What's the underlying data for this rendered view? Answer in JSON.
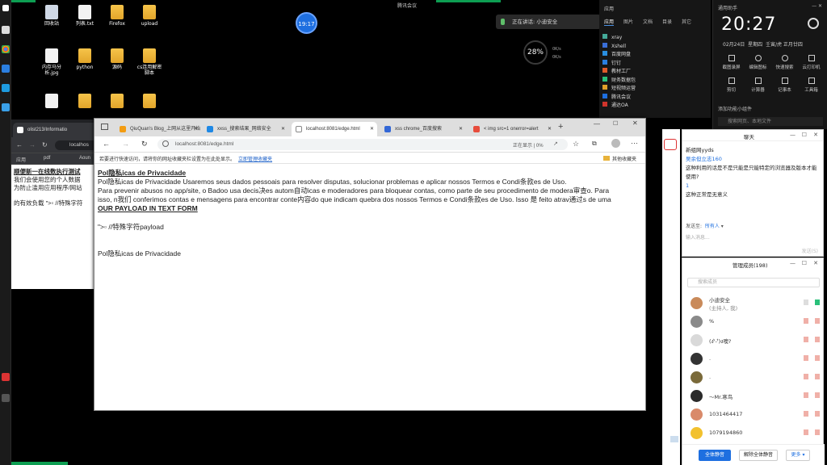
{
  "desktop": {
    "icons": [
      {
        "label": "回收站"
      },
      {
        "label": "列表.txt"
      },
      {
        "label": "Firefox"
      },
      {
        "label": "upload"
      },
      {
        "label": "内存马分析.jpg"
      },
      {
        "label": "python"
      },
      {
        "label": "源码"
      },
      {
        "label": "cs连用解密脚本"
      }
    ],
    "meeting_timer": "19:17",
    "top_meeting_text": "腾讯会议",
    "speaking_text": "正在讲话: 小迪安全",
    "cpu_percent": "28%",
    "net_up": "0K/s",
    "net_down": "0K/s"
  },
  "context_list": {
    "tabs": [
      "应用",
      "图片",
      "文档",
      "目录",
      "其它"
    ],
    "items": [
      "xray",
      "Xshell",
      "百度网盘",
      "钉钉",
      "教材工厂",
      "财务数据包",
      "短视频运营",
      "腾讯会议",
      "通达OA"
    ]
  },
  "assistant": {
    "title": "通用助手",
    "time": "20:27",
    "date": "02月24日",
    "weekday": "星期四",
    "lunar": "壬寅/虎 正月廿四",
    "tools": [
      "截图录屏",
      "编辑图标",
      "快速搜索",
      "云打印机",
      "剪切",
      "计算器",
      "记事本",
      "工具箱"
    ],
    "add_widget": "添加功能小组件",
    "search_placeholder": "搜索网页、本地文件"
  },
  "back_browser": {
    "tabs": [
      {
        "title": "olist213/Informatio"
      }
    ],
    "address": "localhos",
    "bookmarks": [
      "应用",
      "pdf",
      "Aoun"
    ],
    "text_lines": [
      "顺便新一在线数执行测试",
      "我们会使用您的个人数据",
      "为防止滥用应用程序/网站",
      "的有效负载 \">▫ //特殊字符"
    ]
  },
  "browser": {
    "tabs": [
      {
        "title": "QiuQuan's Blog_上网从这里开始"
      },
      {
        "title": "xxss_搜索结果_网络安全"
      },
      {
        "title": "localhost:8081/edge.html"
      },
      {
        "title": "xss chrome_百度搜索"
      },
      {
        "title": "< img src=1 onerror=alert"
      }
    ],
    "address": "localhost:8081/edge.html",
    "address_hint": "正在显示 | 0%",
    "bookmark_notice": "若要进行快速访问，请将你的网址收藏夹栏设置为在此处显示。",
    "bookmark_link": "立即管理收藏夹",
    "other_favorites": "其他收藏夹",
    "page": {
      "heading_line": "Pol隐私icas de Privacidade",
      "line1": "Pol隐私icas de Privacidade Usaremos seus dados pessoais para resolver disputas, solucionar problemas e aplicar nossos Termos e Condi条款es de Uso.",
      "line2": "Para prevenir abusos no app/site, o Badoo usa decis决es autom自动icas e moderadores para bloquear contas, como parte de seu procedimento de modera审查o. Para",
      "line3": "isso, n我们 conferimos contas e mensagens para encontrar conte内容do que indicam quebra dos nossos Termos e Condi条款es de Uso. Isso 是 feito atrav通过s de uma",
      "payload_title": "OUR PAYLOAD IN TEXT FORM",
      "payload": "\">▫ //特殊字符payload",
      "footer_line": "Pol隐私icas de Privacidade"
    }
  },
  "chat": {
    "title": "聊天",
    "messages": [
      "新组网yyds",
      "吴余但立志160",
      "这种利用的话是不是只能是只能特定的浏览器及版本才能使用?",
      "1",
      "这种正常是无意义"
    ],
    "send_to_label": "发送至:",
    "send_to_value": "所有人",
    "input_placeholder": "输入消息...",
    "send_label": "发送(S)"
  },
  "members": {
    "title": "管理成员(198)",
    "search_placeholder": "搜索成员",
    "list": [
      {
        "name": "小迪安全",
        "sub": "(主持人, 我)",
        "color": "#c98a5a"
      },
      {
        "name": "%",
        "color": "#8a8a8a"
      },
      {
        "name": "(ง'̀-'́)ง噢?",
        "color": "#d9d9d9"
      },
      {
        "name": ".",
        "color": "#333"
      },
      {
        "name": ".",
        "color": "#7a6a3a"
      },
      {
        "name": "～Mr.寒鸟",
        "color": "#2a2a2a"
      },
      {
        "name": "1031464417",
        "color": "#d98a6a"
      },
      {
        "name": "1079194860",
        "color": "#f2c12e"
      }
    ],
    "mute_all": "全体静音",
    "unmute_all": "解除全体静音",
    "more": "更多"
  },
  "colors": {
    "accent": "#1e6fe0",
    "desktop_green": "#0d9e52"
  }
}
